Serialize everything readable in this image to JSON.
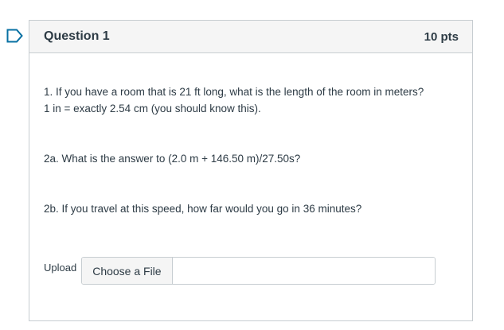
{
  "question": {
    "title": "Question 1",
    "points": "10 pts"
  },
  "body": {
    "q1_line1": "1.  If you have a room that is 21 ft long, what is the length of the room in meters?",
    "q1_line2": "1 in = exactly 2.54 cm (you should know this).",
    "q2a": "2a.  What is the answer to  (2.0 m +  146.50 m)/27.50s?",
    "q2b": "2b.  If you travel at this speed, how far would you go in 36 minutes?"
  },
  "upload": {
    "label": "Upload",
    "button_label": "Choose a File"
  },
  "colors": {
    "flag": "#0770a3",
    "border": "#c7cdd1",
    "header_bg": "#f5f5f5",
    "text": "#2d3b45"
  },
  "icons": {
    "flag": "bookmark-flag-icon"
  }
}
